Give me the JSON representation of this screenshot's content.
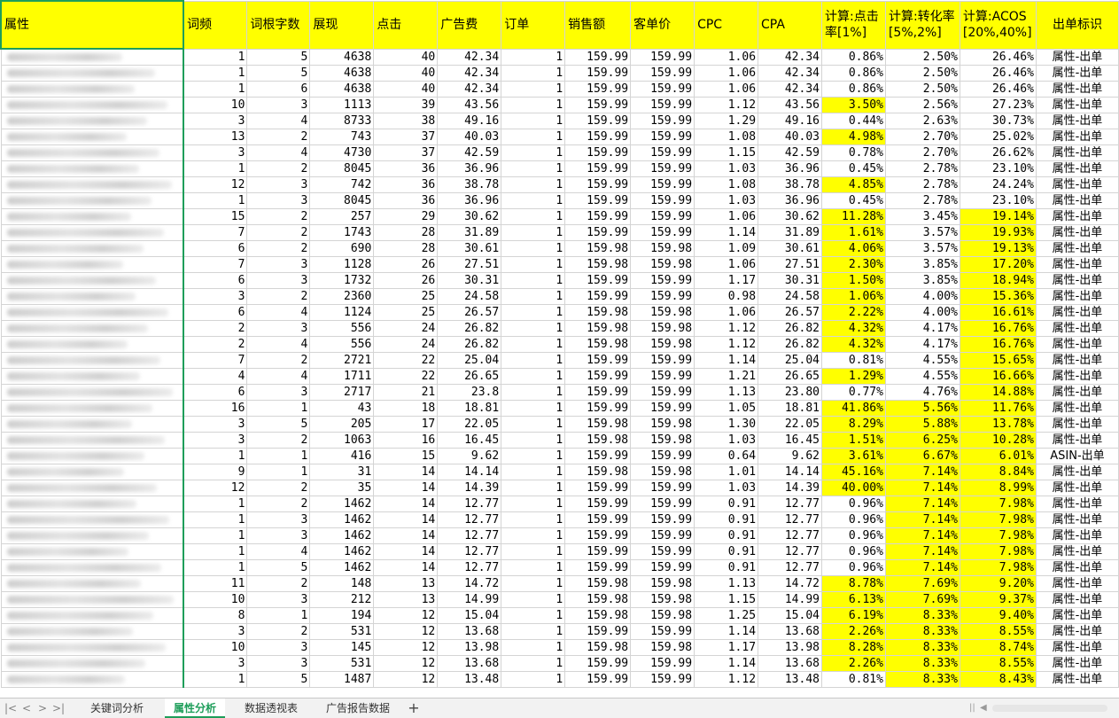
{
  "sheet": {
    "headers": [
      "属性",
      "词频",
      "词根字数",
      "展现",
      "点击",
      "广告费",
      "订单",
      "销售额",
      "客单价",
      "CPC",
      "CPA",
      "计算:点击率[1%]",
      "计算:转化率[5%,2%]",
      "计算:ACOS [20%,40%]",
      "出单标识"
    ],
    "rows": [
      [
        "1",
        "5",
        "4638",
        "40",
        "42.34",
        "1",
        "159.99",
        "159.99",
        "1.06",
        "42.34",
        "0.86%",
        "2.50%",
        "26.46%",
        "属性-出单"
      ],
      [
        "1",
        "5",
        "4638",
        "40",
        "42.34",
        "1",
        "159.99",
        "159.99",
        "1.06",
        "42.34",
        "0.86%",
        "2.50%",
        "26.46%",
        "属性-出单"
      ],
      [
        "1",
        "6",
        "4638",
        "40",
        "42.34",
        "1",
        "159.99",
        "159.99",
        "1.06",
        "42.34",
        "0.86%",
        "2.50%",
        "26.46%",
        "属性-出单"
      ],
      [
        "10",
        "3",
        "1113",
        "39",
        "43.56",
        "1",
        "159.99",
        "159.99",
        "1.12",
        "43.56",
        "3.50%",
        "2.56%",
        "27.23%",
        "属性-出单"
      ],
      [
        "3",
        "4",
        "8733",
        "38",
        "49.16",
        "1",
        "159.99",
        "159.99",
        "1.29",
        "49.16",
        "0.44%",
        "2.63%",
        "30.73%",
        "属性-出单"
      ],
      [
        "13",
        "2",
        "743",
        "37",
        "40.03",
        "1",
        "159.99",
        "159.99",
        "1.08",
        "40.03",
        "4.98%",
        "2.70%",
        "25.02%",
        "属性-出单"
      ],
      [
        "3",
        "4",
        "4730",
        "37",
        "42.59",
        "1",
        "159.99",
        "159.99",
        "1.15",
        "42.59",
        "0.78%",
        "2.70%",
        "26.62%",
        "属性-出单"
      ],
      [
        "1",
        "2",
        "8045",
        "36",
        "36.96",
        "1",
        "159.99",
        "159.99",
        "1.03",
        "36.96",
        "0.45%",
        "2.78%",
        "23.10%",
        "属性-出单"
      ],
      [
        "12",
        "3",
        "742",
        "36",
        "38.78",
        "1",
        "159.99",
        "159.99",
        "1.08",
        "38.78",
        "4.85%",
        "2.78%",
        "24.24%",
        "属性-出单"
      ],
      [
        "1",
        "3",
        "8045",
        "36",
        "36.96",
        "1",
        "159.99",
        "159.99",
        "1.03",
        "36.96",
        "0.45%",
        "2.78%",
        "23.10%",
        "属性-出单"
      ],
      [
        "15",
        "2",
        "257",
        "29",
        "30.62",
        "1",
        "159.99",
        "159.99",
        "1.06",
        "30.62",
        "11.28%",
        "3.45%",
        "19.14%",
        "属性-出单"
      ],
      [
        "7",
        "2",
        "1743",
        "28",
        "31.89",
        "1",
        "159.99",
        "159.99",
        "1.14",
        "31.89",
        "1.61%",
        "3.57%",
        "19.93%",
        "属性-出单"
      ],
      [
        "6",
        "2",
        "690",
        "28",
        "30.61",
        "1",
        "159.98",
        "159.98",
        "1.09",
        "30.61",
        "4.06%",
        "3.57%",
        "19.13%",
        "属性-出单"
      ],
      [
        "7",
        "3",
        "1128",
        "26",
        "27.51",
        "1",
        "159.98",
        "159.98",
        "1.06",
        "27.51",
        "2.30%",
        "3.85%",
        "17.20%",
        "属性-出单"
      ],
      [
        "6",
        "3",
        "1732",
        "26",
        "30.31",
        "1",
        "159.99",
        "159.99",
        "1.17",
        "30.31",
        "1.50%",
        "3.85%",
        "18.94%",
        "属性-出单"
      ],
      [
        "3",
        "2",
        "2360",
        "25",
        "24.58",
        "1",
        "159.99",
        "159.99",
        "0.98",
        "24.58",
        "1.06%",
        "4.00%",
        "15.36%",
        "属性-出单"
      ],
      [
        "6",
        "4",
        "1124",
        "25",
        "26.57",
        "1",
        "159.98",
        "159.98",
        "1.06",
        "26.57",
        "2.22%",
        "4.00%",
        "16.61%",
        "属性-出单"
      ],
      [
        "2",
        "3",
        "556",
        "24",
        "26.82",
        "1",
        "159.98",
        "159.98",
        "1.12",
        "26.82",
        "4.32%",
        "4.17%",
        "16.76%",
        "属性-出单"
      ],
      [
        "2",
        "4",
        "556",
        "24",
        "26.82",
        "1",
        "159.98",
        "159.98",
        "1.12",
        "26.82",
        "4.32%",
        "4.17%",
        "16.76%",
        "属性-出单"
      ],
      [
        "7",
        "2",
        "2721",
        "22",
        "25.04",
        "1",
        "159.99",
        "159.99",
        "1.14",
        "25.04",
        "0.81%",
        "4.55%",
        "15.65%",
        "属性-出单"
      ],
      [
        "4",
        "4",
        "1711",
        "22",
        "26.65",
        "1",
        "159.99",
        "159.99",
        "1.21",
        "26.65",
        "1.29%",
        "4.55%",
        "16.66%",
        "属性-出单"
      ],
      [
        "6",
        "3",
        "2717",
        "21",
        "23.8",
        "1",
        "159.99",
        "159.99",
        "1.13",
        "23.80",
        "0.77%",
        "4.76%",
        "14.88%",
        "属性-出单"
      ],
      [
        "16",
        "1",
        "43",
        "18",
        "18.81",
        "1",
        "159.99",
        "159.99",
        "1.05",
        "18.81",
        "41.86%",
        "5.56%",
        "11.76%",
        "属性-出单"
      ],
      [
        "3",
        "5",
        "205",
        "17",
        "22.05",
        "1",
        "159.98",
        "159.98",
        "1.30",
        "22.05",
        "8.29%",
        "5.88%",
        "13.78%",
        "属性-出单"
      ],
      [
        "3",
        "2",
        "1063",
        "16",
        "16.45",
        "1",
        "159.98",
        "159.98",
        "1.03",
        "16.45",
        "1.51%",
        "6.25%",
        "10.28%",
        "属性-出单"
      ],
      [
        "1",
        "1",
        "416",
        "15",
        "9.62",
        "1",
        "159.99",
        "159.99",
        "0.64",
        "9.62",
        "3.61%",
        "6.67%",
        "6.01%",
        "ASIN-出单"
      ],
      [
        "9",
        "1",
        "31",
        "14",
        "14.14",
        "1",
        "159.98",
        "159.98",
        "1.01",
        "14.14",
        "45.16%",
        "7.14%",
        "8.84%",
        "属性-出单"
      ],
      [
        "12",
        "2",
        "35",
        "14",
        "14.39",
        "1",
        "159.99",
        "159.99",
        "1.03",
        "14.39",
        "40.00%",
        "7.14%",
        "8.99%",
        "属性-出单"
      ],
      [
        "1",
        "2",
        "1462",
        "14",
        "12.77",
        "1",
        "159.99",
        "159.99",
        "0.91",
        "12.77",
        "0.96%",
        "7.14%",
        "7.98%",
        "属性-出单"
      ],
      [
        "1",
        "3",
        "1462",
        "14",
        "12.77",
        "1",
        "159.99",
        "159.99",
        "0.91",
        "12.77",
        "0.96%",
        "7.14%",
        "7.98%",
        "属性-出单"
      ],
      [
        "1",
        "3",
        "1462",
        "14",
        "12.77",
        "1",
        "159.99",
        "159.99",
        "0.91",
        "12.77",
        "0.96%",
        "7.14%",
        "7.98%",
        "属性-出单"
      ],
      [
        "1",
        "4",
        "1462",
        "14",
        "12.77",
        "1",
        "159.99",
        "159.99",
        "0.91",
        "12.77",
        "0.96%",
        "7.14%",
        "7.98%",
        "属性-出单"
      ],
      [
        "1",
        "5",
        "1462",
        "14",
        "12.77",
        "1",
        "159.99",
        "159.99",
        "0.91",
        "12.77",
        "0.96%",
        "7.14%",
        "7.98%",
        "属性-出单"
      ],
      [
        "11",
        "2",
        "148",
        "13",
        "14.72",
        "1",
        "159.98",
        "159.98",
        "1.13",
        "14.72",
        "8.78%",
        "7.69%",
        "9.20%",
        "属性-出单"
      ],
      [
        "10",
        "3",
        "212",
        "13",
        "14.99",
        "1",
        "159.98",
        "159.98",
        "1.15",
        "14.99",
        "6.13%",
        "7.69%",
        "9.37%",
        "属性-出单"
      ],
      [
        "8",
        "1",
        "194",
        "12",
        "15.04",
        "1",
        "159.98",
        "159.98",
        "1.25",
        "15.04",
        "6.19%",
        "8.33%",
        "9.40%",
        "属性-出单"
      ],
      [
        "3",
        "2",
        "531",
        "12",
        "13.68",
        "1",
        "159.99",
        "159.99",
        "1.14",
        "13.68",
        "2.26%",
        "8.33%",
        "8.55%",
        "属性-出单"
      ],
      [
        "10",
        "3",
        "145",
        "12",
        "13.98",
        "1",
        "159.98",
        "159.98",
        "1.17",
        "13.98",
        "8.28%",
        "8.33%",
        "8.74%",
        "属性-出单"
      ],
      [
        "3",
        "3",
        "531",
        "12",
        "13.68",
        "1",
        "159.99",
        "159.99",
        "1.14",
        "13.68",
        "2.26%",
        "8.33%",
        "8.55%",
        "属性-出单"
      ],
      [
        "1",
        "5",
        "1487",
        "12",
        "13.48",
        "1",
        "159.99",
        "159.99",
        "1.12",
        "13.48",
        "0.81%",
        "8.33%",
        "8.43%",
        "属性-出单"
      ]
    ]
  },
  "tabs": [
    "关键词分析",
    "属性分析",
    "数据透视表",
    "广告报告数据"
  ],
  "active_tab": "属性分析",
  "add_tab_label": "+",
  "nav": [
    "|<",
    "<",
    ">",
    ">|"
  ],
  "highlight_color": "#ffff00"
}
